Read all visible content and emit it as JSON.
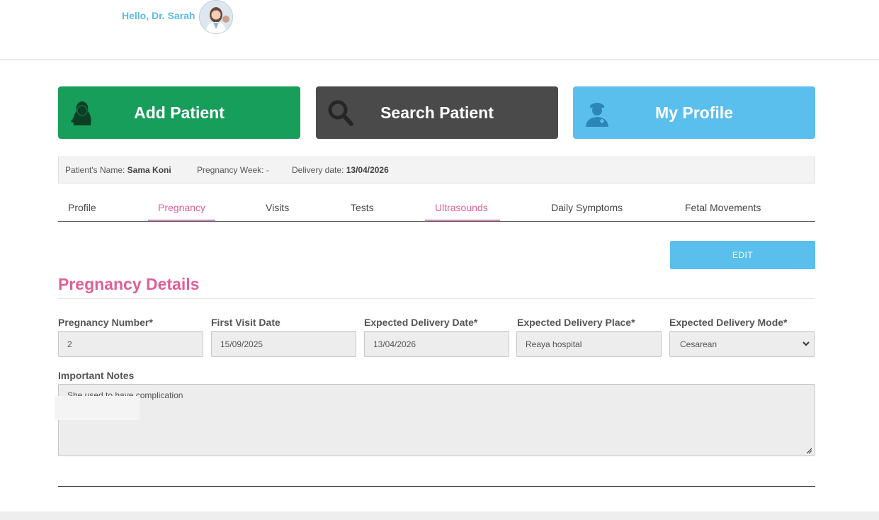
{
  "header": {
    "greeting": "Hello, Dr. Sarah",
    "avatar_icon": "doctor-avatar-icon"
  },
  "actions": {
    "add_patient": {
      "label": "Add Patient",
      "color": "#189e5b",
      "icon": "patient-woman-icon"
    },
    "search_patient": {
      "label": "Search Patient",
      "color": "#4a4a4a",
      "icon": "magnifier-icon"
    },
    "my_profile": {
      "label": "My Profile",
      "color": "#5bbfed",
      "icon": "doctor-icon"
    }
  },
  "patient_info": {
    "name_label": "Patient's Name:",
    "name_value": "Sama Koni",
    "week_label": "Pregnancy Week:",
    "week_value": "-",
    "delivery_label": "Delivery date:",
    "delivery_value": "13/04/2026"
  },
  "tabs": [
    {
      "label": "Profile",
      "active": false
    },
    {
      "label": "Pregnancy",
      "active": true
    },
    {
      "label": "Visits",
      "active": false
    },
    {
      "label": "Tests",
      "active": false
    },
    {
      "label": "Ultrasounds",
      "active": true
    },
    {
      "label": "Daily Symptoms",
      "active": false
    },
    {
      "label": "Fetal Movements",
      "active": false
    }
  ],
  "edit_label": "EDIT",
  "section_title": "Pregnancy Details",
  "fields": {
    "pregnancy_number": {
      "label": "Pregnancy Number*",
      "value": "2"
    },
    "first_visit_date": {
      "label": "First Visit Date",
      "value": "15/09/2025"
    },
    "expected_delivery_date": {
      "label": "Expected Delivery Date*",
      "value": "13/04/2026"
    },
    "expected_delivery_place": {
      "label": "Expected Delivery Place*",
      "value": "Reaya hospital"
    },
    "expected_delivery_mode": {
      "label": "Expected Delivery Mode*",
      "value": "Cesarean"
    }
  },
  "notes": {
    "label": "Important Notes",
    "value": "She used to have complication"
  },
  "colors": {
    "accent_pink": "#e0609a",
    "accent_blue": "#5bbfed"
  }
}
